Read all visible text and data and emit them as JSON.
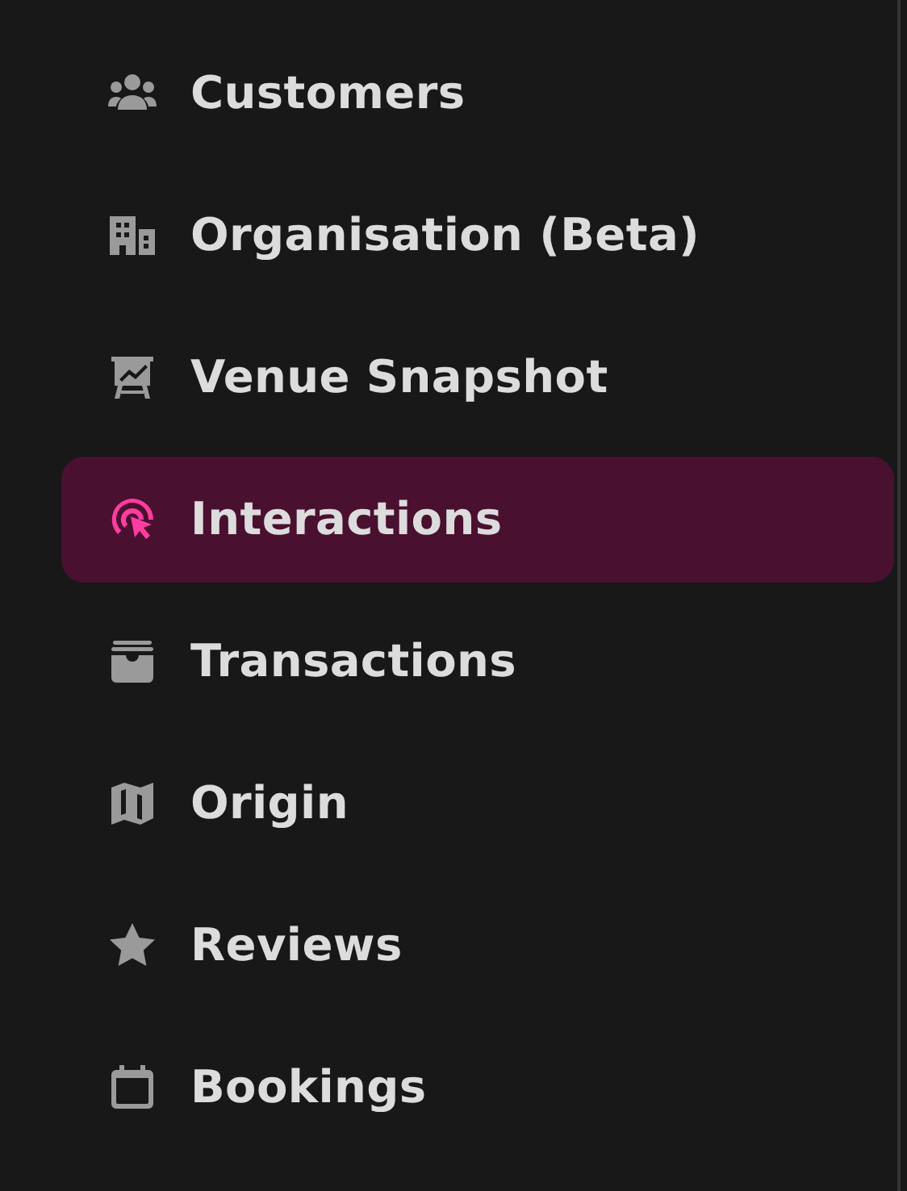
{
  "sidebar": {
    "items": [
      {
        "label": "Customers",
        "selected": false
      },
      {
        "label": "Organisation (Beta)",
        "selected": false
      },
      {
        "label": "Venue Snapshot",
        "selected": false
      },
      {
        "label": "Interactions",
        "selected": true
      },
      {
        "label": "Transactions",
        "selected": false
      },
      {
        "label": "Origin",
        "selected": false
      },
      {
        "label": "Reviews",
        "selected": false
      },
      {
        "label": "Bookings",
        "selected": false
      }
    ]
  }
}
